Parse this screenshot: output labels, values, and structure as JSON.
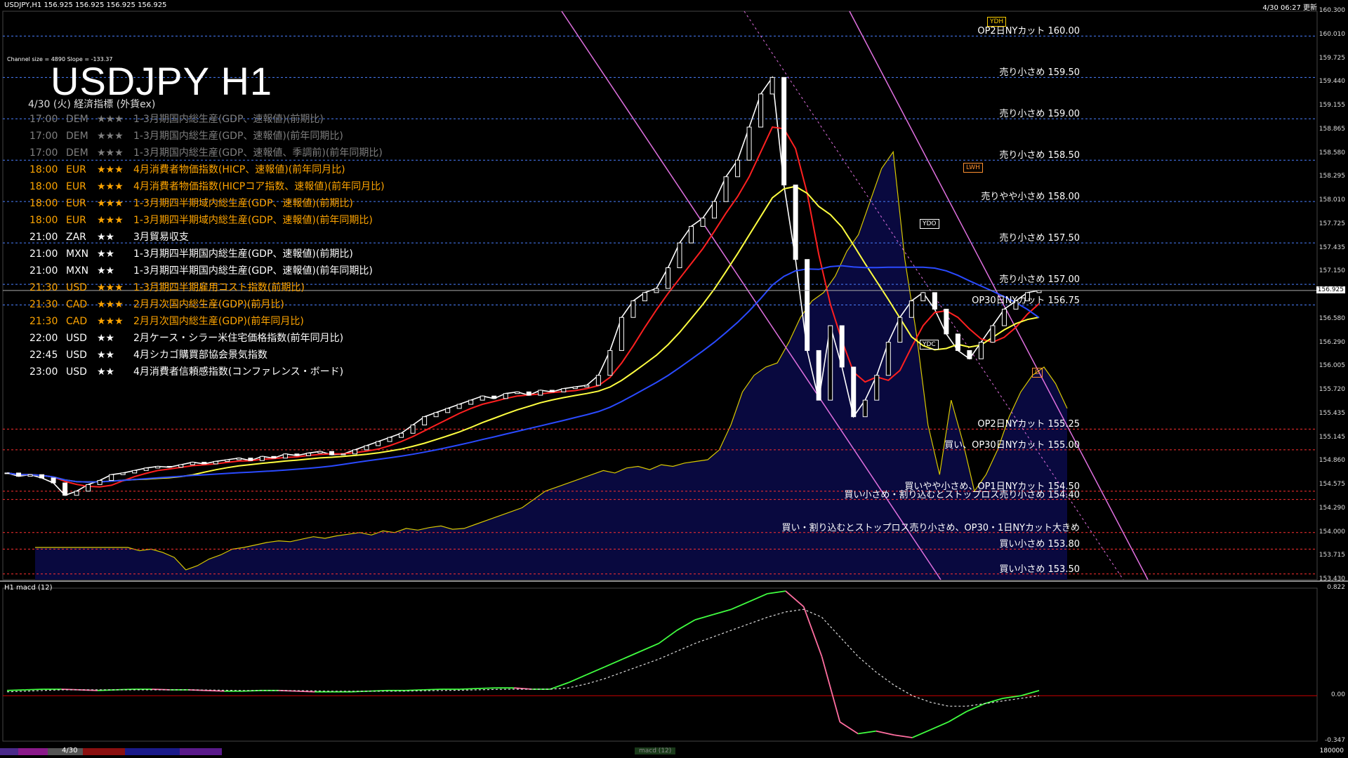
{
  "window": {
    "title": "USDJPY,H1  156.925 156.925 156.925 156.925",
    "clock": "4/30 06:27 更新"
  },
  "channel": {
    "info": "Channel size = 4890 Slope = -133.37"
  },
  "heading": {
    "title": "USDJPY H1"
  },
  "calendar": {
    "header": "4/30 (火) 経済指標 (外貨ex)",
    "rows": [
      {
        "time": "17:00",
        "currency": "DEM",
        "stars": "★★★",
        "name": "1-3月期国内総生産(GDP、速報値)(前期比)",
        "color": "#7f7f7f"
      },
      {
        "time": "17:00",
        "currency": "DEM",
        "stars": "★★★",
        "name": "1-3月期国内総生産(GDP、速報値)(前年同期比)",
        "color": "#7f7f7f"
      },
      {
        "time": "17:00",
        "currency": "DEM",
        "stars": "★★★",
        "name": "1-3月期国内総生産(GDP、速報値、季調前)(前年同期比)",
        "color": "#7f7f7f"
      },
      {
        "time": "18:00",
        "currency": "EUR",
        "stars": "★★★",
        "name": "4月消費者物価指数(HICP、速報値)(前年同月比)",
        "color": "#ffa500"
      },
      {
        "time": "18:00",
        "currency": "EUR",
        "stars": "★★★",
        "name": "4月消費者物価指数(HICPコア指数、速報値)(前年同月比)",
        "color": "#ffa500"
      },
      {
        "time": "18:00",
        "currency": "EUR",
        "stars": "★★★",
        "name": "1-3月期四半期域内総生産(GDP、速報値)(前期比)",
        "color": "#ffa500"
      },
      {
        "time": "18:00",
        "currency": "EUR",
        "stars": "★★★",
        "name": "1-3月期四半期域内総生産(GDP、速報値)(前年同期比)",
        "color": "#ffa500"
      },
      {
        "time": "21:00",
        "currency": "ZAR",
        "stars": "★★",
        "name": "3月貿易収支",
        "color": "#ffffff"
      },
      {
        "time": "21:00",
        "currency": "MXN",
        "stars": "★★",
        "name": "1-3月期四半期国内総生産(GDP、速報値)(前期比)",
        "color": "#ffffff"
      },
      {
        "time": "21:00",
        "currency": "MXN",
        "stars": "★★",
        "name": "1-3月期四半期国内総生産(GDP、速報値)(前年同期比)",
        "color": "#ffffff"
      },
      {
        "time": "21:30",
        "currency": "USD",
        "stars": "★★★",
        "name": "1-3月期四半期雇用コスト指数(前期比)",
        "color": "#ffa500"
      },
      {
        "time": "21:30",
        "currency": "CAD",
        "stars": "★★★",
        "name": "2月月次国内総生産(GDP)(前月比)",
        "color": "#ffa500"
      },
      {
        "time": "21:30",
        "currency": "CAD",
        "stars": "★★★",
        "name": "2月月次国内総生産(GDP)(前年同月比)",
        "color": "#ffa500"
      },
      {
        "time": "22:00",
        "currency": "USD",
        "stars": "★★",
        "name": "2月ケース・シラー米住宅価格指数(前年同月比)",
        "color": "#ffffff"
      },
      {
        "time": "22:45",
        "currency": "USD",
        "stars": "★★",
        "name": "4月シカゴ購買部協会景気指数",
        "color": "#ffffff"
      },
      {
        "time": "23:00",
        "currency": "USD",
        "stars": "★★",
        "name": "4月消費者信頼感指数(コンファレンス・ボード)",
        "color": "#ffffff"
      }
    ]
  },
  "chart_data": {
    "type": "line",
    "symbol": "USDJPY",
    "timeframe": "H1",
    "current_price": 156.925,
    "ylim": [
      153.43,
      160.3
    ],
    "price_ticks": [
      "160.300",
      "160.010",
      "159.725",
      "159.440",
      "159.155",
      "158.865",
      "158.580",
      "158.295",
      "158.010",
      "157.725",
      "157.435",
      "157.150",
      "156.925",
      "156.580",
      "156.290",
      "156.005",
      "155.720",
      "155.435",
      "155.145",
      "154.860",
      "154.575",
      "154.290",
      "154.000",
      "153.715",
      "153.430"
    ],
    "levels": [
      {
        "price": 160.0,
        "label": "OP2日NYカット 160.00",
        "color": "#4a7fff"
      },
      {
        "price": 159.5,
        "label": "売り小さめ 159.50",
        "color": "#4a7fff"
      },
      {
        "price": 159.0,
        "label": "売り小さめ 159.00",
        "color": "#4a7fff"
      },
      {
        "price": 158.5,
        "label": "売り小さめ 158.50",
        "color": "#4a7fff"
      },
      {
        "price": 158.0,
        "label": "売りやや小さめ 158.00",
        "color": "#4a7fff"
      },
      {
        "price": 157.5,
        "label": "売り小さめ 157.50",
        "color": "#4a7fff"
      },
      {
        "price": 157.0,
        "label": "売り小さめ 157.00",
        "color": "#4a7fff"
      },
      {
        "price": 156.75,
        "label": "OP30日NYカット 156.75",
        "color": "#4a7fff"
      },
      {
        "price": 155.25,
        "label": "OP2日NYカット 155.25",
        "color": "#ff3030"
      },
      {
        "price": 155.0,
        "label": "買い、OP30日NYカット 155.00",
        "color": "#ff3030"
      },
      {
        "price": 154.5,
        "label": "買いやや小さめ、OP1日NYカット 154.50",
        "color": "#ff3030"
      },
      {
        "price": 154.4,
        "label": "買い小さめ・割り込むとストップロス売り小さめ 154.40",
        "color": "#ff3030"
      },
      {
        "price": 154.0,
        "label": "買い・割り込むとストップロス売り小さめ、OP30・1日NYカット大きめ",
        "color": "#ff3030"
      },
      {
        "price": 153.8,
        "label": "買い小さめ 153.80",
        "color": "#ff3030"
      },
      {
        "price": 153.5,
        "label": "買い小さめ 153.50",
        "color": "#ff3030"
      }
    ],
    "tags": [
      "YDH",
      "YDO",
      "YDC",
      "LWH",
      "D"
    ],
    "close": [
      154.72,
      154.68,
      154.7,
      154.66,
      154.6,
      154.45,
      154.5,
      154.58,
      154.63,
      154.7,
      154.72,
      154.75,
      154.78,
      154.8,
      154.79,
      154.82,
      154.85,
      154.83,
      154.86,
      154.88,
      154.9,
      154.87,
      154.92,
      154.9,
      154.95,
      154.93,
      154.96,
      154.98,
      154.94,
      154.95,
      155.0,
      155.05,
      155.1,
      155.15,
      155.2,
      155.3,
      155.4,
      155.45,
      155.5,
      155.55,
      155.6,
      155.65,
      155.62,
      155.68,
      155.7,
      155.66,
      155.72,
      155.7,
      155.74,
      155.76,
      155.78,
      155.9,
      156.2,
      156.6,
      156.8,
      156.9,
      156.95,
      157.2,
      157.5,
      157.7,
      157.8,
      158.0,
      158.3,
      158.5,
      158.9,
      159.3,
      159.5,
      158.2,
      157.3,
      156.2,
      155.6,
      156.5,
      156.0,
      155.4,
      155.6,
      155.9,
      156.3,
      156.6,
      156.8,
      156.9,
      156.7,
      156.4,
      156.2,
      156.1,
      156.3,
      156.5,
      156.7,
      156.8,
      156.9,
      156.925
    ],
    "macd": {
      "name": "H1 macd (12)",
      "ylim": [
        -0.347,
        0.822
      ],
      "ticks": [
        "0.822",
        "0.00",
        "-0.347"
      ],
      "main": [
        0.04,
        0.045,
        0.05,
        0.05,
        0.045,
        0.04,
        0.045,
        0.05,
        0.05,
        0.045,
        0.045,
        0.04,
        0.035,
        0.035,
        0.04,
        0.04,
        0.035,
        0.03,
        0.03,
        0.03,
        0.035,
        0.04,
        0.04,
        0.045,
        0.05,
        0.05,
        0.055,
        0.06,
        0.06,
        0.05,
        0.05,
        0.1,
        0.16,
        0.22,
        0.28,
        0.34,
        0.4,
        0.5,
        0.58,
        0.62,
        0.66,
        0.72,
        0.78,
        0.8,
        0.68,
        0.3,
        -0.2,
        -0.29,
        -0.27,
        -0.3,
        -0.32,
        -0.26,
        -0.2,
        -0.12,
        -0.06,
        -0.02,
        0.0,
        0.04
      ],
      "signal": [
        0.03,
        0.035,
        0.04,
        0.045,
        0.045,
        0.045,
        0.045,
        0.045,
        0.045,
        0.045,
        0.045,
        0.044,
        0.042,
        0.04,
        0.04,
        0.04,
        0.039,
        0.037,
        0.035,
        0.034,
        0.034,
        0.035,
        0.036,
        0.038,
        0.04,
        0.042,
        0.045,
        0.048,
        0.05,
        0.05,
        0.05,
        0.06,
        0.09,
        0.13,
        0.18,
        0.23,
        0.28,
        0.34,
        0.4,
        0.45,
        0.5,
        0.55,
        0.6,
        0.64,
        0.66,
        0.6,
        0.45,
        0.3,
        0.18,
        0.08,
        0.0,
        -0.05,
        -0.08,
        -0.08,
        -0.06,
        -0.04,
        -0.02,
        0.0
      ]
    }
  },
  "bottom": {
    "date_label": "4/30",
    "indicator_tab": "macd (12)",
    "right_label": "180000"
  }
}
